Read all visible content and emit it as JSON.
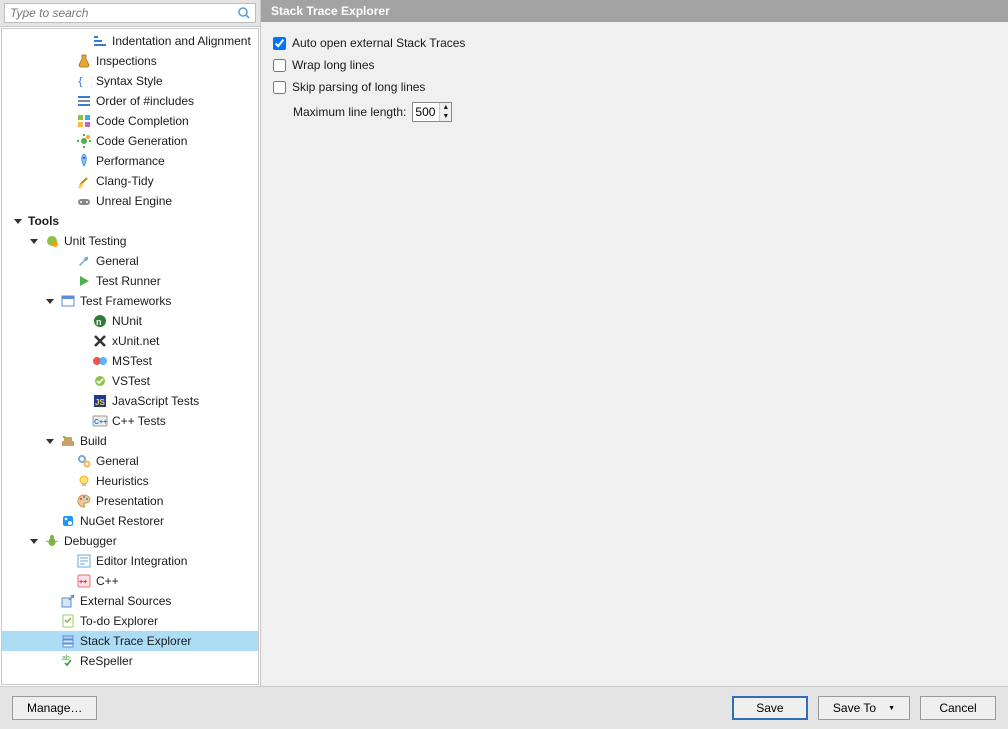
{
  "search": {
    "placeholder": "Type to search"
  },
  "tree": [
    {
      "label": "Indentation and Alignment",
      "indent": 70,
      "icon": "indent",
      "bold": false
    },
    {
      "label": "Inspections",
      "indent": 54,
      "icon": "flask",
      "bold": false
    },
    {
      "label": "Syntax Style",
      "indent": 54,
      "icon": "braces",
      "bold": false
    },
    {
      "label": "Order of #includes",
      "indent": 54,
      "icon": "lines",
      "bold": false
    },
    {
      "label": "Code Completion",
      "indent": 54,
      "icon": "cubes",
      "bold": false
    },
    {
      "label": "Code Generation",
      "indent": 54,
      "icon": "cog",
      "bold": false
    },
    {
      "label": "Performance",
      "indent": 54,
      "icon": "rocket",
      "bold": false
    },
    {
      "label": "Clang-Tidy",
      "indent": 54,
      "icon": "broom",
      "bold": false
    },
    {
      "label": "Unreal Engine",
      "indent": 54,
      "icon": "gamepad",
      "bold": false
    },
    {
      "label": "Tools",
      "indent": 6,
      "icon": "none",
      "expander": "down",
      "bold": true
    },
    {
      "label": "Unit Testing",
      "indent": 22,
      "icon": "orb-green",
      "expander": "down",
      "bold": false
    },
    {
      "label": "General",
      "indent": 54,
      "icon": "wrench",
      "bold": false
    },
    {
      "label": "Test Runner",
      "indent": 54,
      "icon": "arrow-green",
      "bold": false
    },
    {
      "label": "Test Frameworks",
      "indent": 38,
      "icon": "window",
      "expander": "down",
      "bold": false
    },
    {
      "label": "NUnit",
      "indent": 70,
      "icon": "nunit",
      "bold": false
    },
    {
      "label": "xUnit.net",
      "indent": 70,
      "icon": "xunit",
      "bold": false
    },
    {
      "label": "MSTest",
      "indent": 70,
      "icon": "mstest",
      "bold": false
    },
    {
      "label": "VSTest",
      "indent": 70,
      "icon": "vstest",
      "bold": false
    },
    {
      "label": "JavaScript Tests",
      "indent": 70,
      "icon": "jstest",
      "bold": false
    },
    {
      "label": "C++ Tests",
      "indent": 70,
      "icon": "cpp",
      "bold": false
    },
    {
      "label": "Build",
      "indent": 38,
      "icon": "build",
      "expander": "down",
      "bold": false
    },
    {
      "label": "General",
      "indent": 54,
      "icon": "gears",
      "bold": false
    },
    {
      "label": "Heuristics",
      "indent": 54,
      "icon": "bulb",
      "bold": false
    },
    {
      "label": "Presentation",
      "indent": 54,
      "icon": "palette",
      "bold": false
    },
    {
      "label": "NuGet Restorer",
      "indent": 38,
      "icon": "nuget",
      "bold": false
    },
    {
      "label": "Debugger",
      "indent": 22,
      "icon": "bug",
      "expander": "down",
      "bold": false
    },
    {
      "label": "Editor Integration",
      "indent": 54,
      "icon": "editor",
      "bold": false
    },
    {
      "label": "C++",
      "indent": 54,
      "icon": "cpp2",
      "bold": false
    },
    {
      "label": "External Sources",
      "indent": 38,
      "icon": "extsrc",
      "bold": false
    },
    {
      "label": "To-do Explorer",
      "indent": 38,
      "icon": "todo",
      "bold": false
    },
    {
      "label": "Stack Trace Explorer",
      "indent": 38,
      "icon": "stack",
      "bold": false,
      "selected": true
    },
    {
      "label": "ReSpeller",
      "indent": 38,
      "icon": "respell",
      "bold": false
    }
  ],
  "panel": {
    "title": "Stack Trace Explorer",
    "opt_auto_open": "Auto open external Stack Traces",
    "opt_wrap": "Wrap long lines",
    "opt_skip": "Skip parsing of long lines",
    "max_len_label": "Maximum line length:",
    "max_len_value": "500",
    "auto_open_checked": true,
    "wrap_checked": false,
    "skip_checked": false
  },
  "footer": {
    "manage": "Manage…",
    "save": "Save",
    "save_to": "Save To",
    "cancel": "Cancel"
  }
}
